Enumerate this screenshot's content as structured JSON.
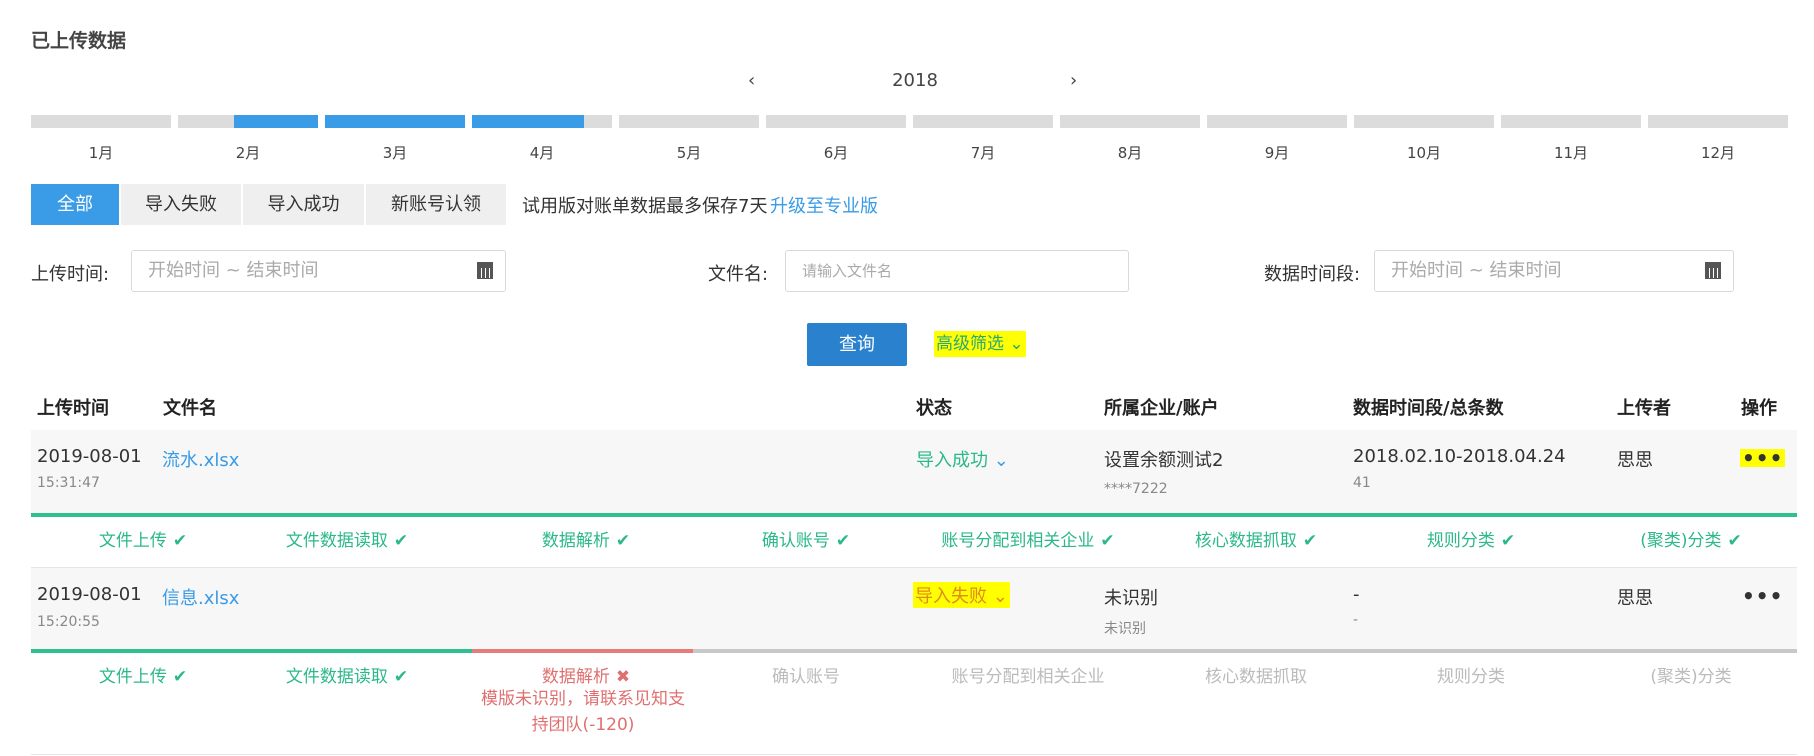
{
  "page_title": "已上传数据",
  "year_nav": {
    "prev": "‹",
    "year": "2018",
    "next": "›"
  },
  "months": [
    {
      "label": "1月",
      "fill": 0
    },
    {
      "label": "2月",
      "fill": 0.6
    },
    {
      "label": "3月",
      "fill": 1
    },
    {
      "label": "4月",
      "fill": 0.8
    },
    {
      "label": "5月",
      "fill": 0
    },
    {
      "label": "6月",
      "fill": 0
    },
    {
      "label": "7月",
      "fill": 0
    },
    {
      "label": "8月",
      "fill": 0
    },
    {
      "label": "9月",
      "fill": 0
    },
    {
      "label": "10月",
      "fill": 0
    },
    {
      "label": "11月",
      "fill": 0
    },
    {
      "label": "12月",
      "fill": 0
    }
  ],
  "colors": {
    "accent": "#3a9be6",
    "success": "#2bb88a",
    "error": "#e07070",
    "highlight": "#ffff00"
  },
  "tabs": [
    {
      "label": "全部",
      "active": true
    },
    {
      "label": "导入失败",
      "active": false
    },
    {
      "label": "导入成功",
      "active": false
    },
    {
      "label": "新账号认领",
      "active": false
    }
  ],
  "trial_note": "试用版对账单数据最多保存7天",
  "upgrade_link": "升级至专业版",
  "filters": {
    "upload_time": {
      "label": "上传时间:",
      "placeholder": "开始时间 ~ 结束时间",
      "icon": "calendar-icon"
    },
    "file_name": {
      "label": "文件名:",
      "placeholder": "请输入文件名"
    },
    "data_period": {
      "label": "数据时间段:",
      "placeholder": "开始时间 ~ 结束时间",
      "icon": "calendar-icon"
    }
  },
  "query_button": "查询",
  "advanced_filter": "高级筛选",
  "table": {
    "headers": [
      "上传时间",
      "文件名",
      "状态",
      "所属企业/账户",
      "数据时间段/总条数",
      "上传者",
      "操作"
    ],
    "rows": [
      {
        "date": "2019-08-01",
        "time": "15:31:47",
        "file": "流水.xlsx",
        "status": "导入成功",
        "company": "设置余额测试2",
        "account": "****7222",
        "period": "2018.02.10-2018.04.24",
        "count": "41",
        "uploader": "思思",
        "more": "•••",
        "steps": [
          "文件上传",
          "文件数据读取",
          "数据解析",
          "确认账号",
          "账号分配到相关企业",
          "核心数据抓取",
          "规则分类",
          "(聚类)分类"
        ],
        "check": "✔"
      },
      {
        "date": "2019-08-01",
        "time": "15:20:55",
        "file": "信息.xlsx",
        "status": "导入失败",
        "company": "未识别",
        "account": "未识别",
        "period": "-",
        "count": "-",
        "uploader": "思思",
        "more": "•••",
        "steps": [
          "文件上传",
          "文件数据读取",
          "数据解析",
          "确认账号",
          "账号分配到相关企业",
          "核心数据抓取",
          "规则分类",
          "(聚类)分类"
        ],
        "check": "✔",
        "fail_mark": "✖",
        "error_line1": "模版未识别，请联系见知支",
        "error_line2": "持团队(-120)"
      }
    ]
  }
}
